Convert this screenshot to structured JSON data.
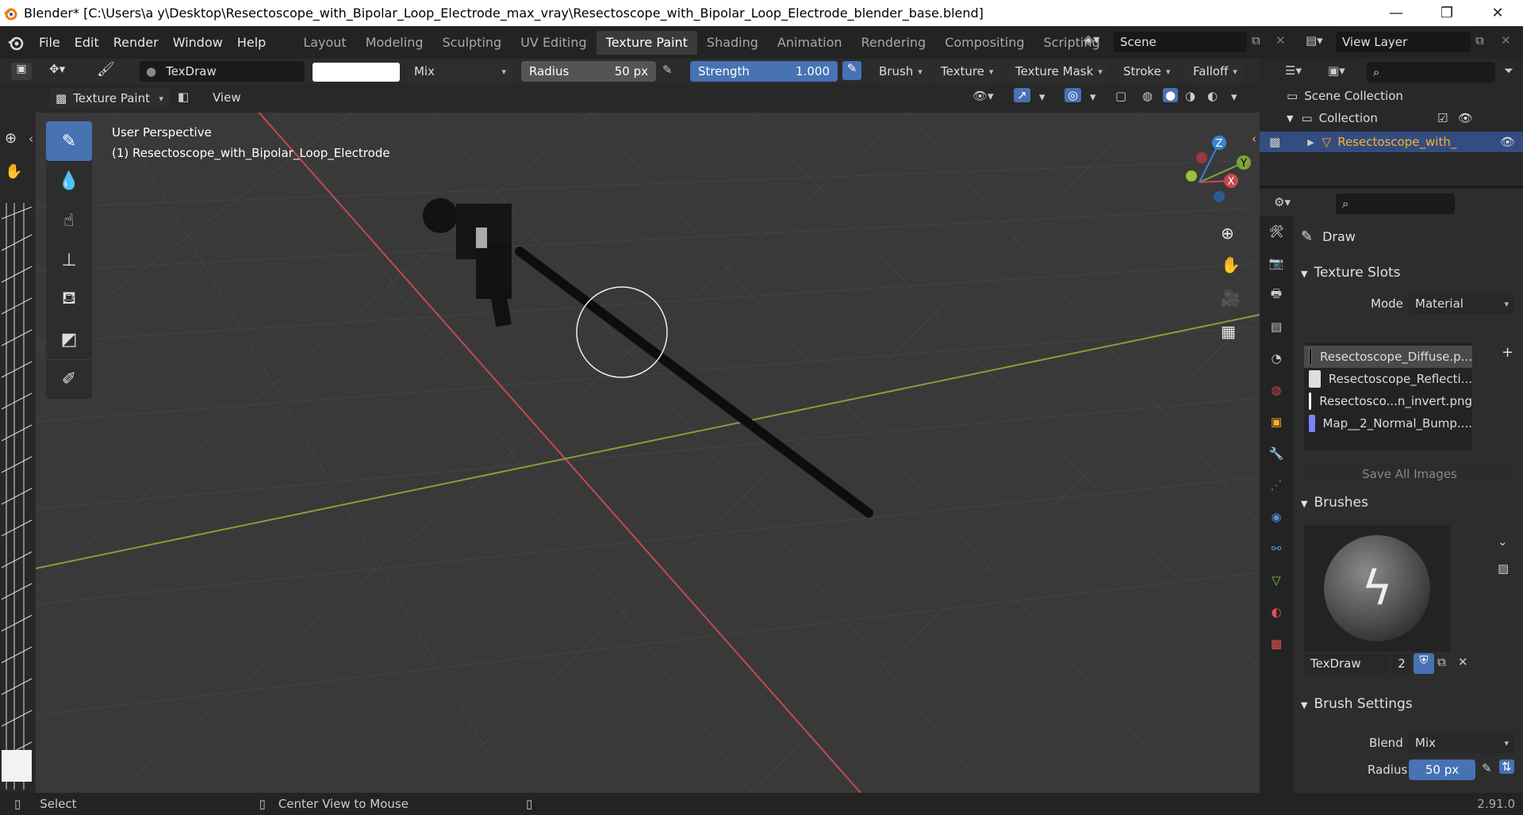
{
  "window": {
    "title": "Blender* [C:\\Users\\a y\\Desktop\\Resectoscope_with_Bipolar_Loop_Electrode_max_vray\\Resectoscope_with_Bipolar_Loop_Electrode_blender_base.blend]",
    "minimize": "—",
    "maximize": "❐",
    "close": "✕"
  },
  "menu": [
    "File",
    "Edit",
    "Render",
    "Window",
    "Help"
  ],
  "workspaces": [
    "Layout",
    "Modeling",
    "Sculpting",
    "UV Editing",
    "Texture Paint",
    "Shading",
    "Animation",
    "Rendering",
    "Compositing",
    "Scripting"
  ],
  "active_workspace": "Texture Paint",
  "scene": {
    "name": "Scene",
    "view_layer": "View Layer"
  },
  "tool_header": {
    "brush_name": "TexDraw",
    "blend": "Mix",
    "radius_label": "Radius",
    "radius_value": "50 px",
    "strength_label": "Strength",
    "strength_value": "1.000",
    "menus": [
      "Brush",
      "Texture",
      "Texture Mask",
      "Stroke",
      "Falloff"
    ]
  },
  "mode_header": {
    "mode": "Texture Paint",
    "view": "View"
  },
  "viewport": {
    "perspective": "User Perspective",
    "object": "(1) Resectoscope_with_Bipolar_Loop_Electrode",
    "gizmo": {
      "z": "Z",
      "y": "Y",
      "x": "X"
    }
  },
  "outliner": {
    "scene_collection": "Scene Collection",
    "collection": "Collection",
    "object": "Resectoscope_with_"
  },
  "properties": {
    "tool_name": "Draw",
    "texture_slots_title": "Texture Slots",
    "mode_label": "Mode",
    "mode_value": "Material",
    "slots": [
      {
        "name": "Resectoscope_Diffuse.p...",
        "color": "#111111"
      },
      {
        "name": "Resectoscope_Reflecti...",
        "color": "#dddddd"
      },
      {
        "name": "Resectosco...n_invert.png",
        "color": "#f4f4f4"
      },
      {
        "name": "Map__2_Normal_Bump....",
        "color": "#8080ff"
      }
    ],
    "save_all": "Save All Images",
    "brushes_title": "Brushes",
    "brush_name": "TexDraw",
    "brush_users": "2",
    "brush_settings_title": "Brush Settings",
    "blend_label": "Blend",
    "blend_value": "Mix",
    "radius_label": "Radius",
    "radius_value": "50 px"
  },
  "status": {
    "select": "Select",
    "center": "Center View to Mouse",
    "version": "2.91.0"
  },
  "colors": {
    "accent": "#4772b3",
    "x_axis": "#c8484f",
    "y_axis": "#7ea33a",
    "z_axis": "#3b84d6"
  }
}
